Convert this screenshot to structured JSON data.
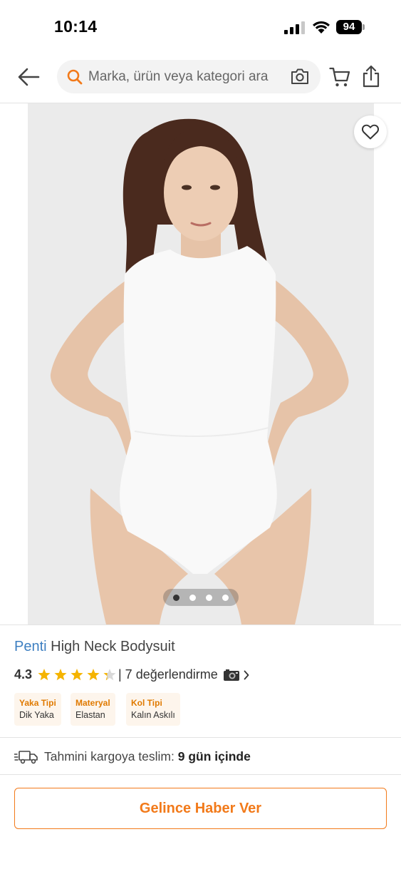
{
  "status_bar": {
    "time": "10:14",
    "battery": "94"
  },
  "search": {
    "placeholder": "Marka, ürün veya kategori ara"
  },
  "carousel": {
    "total": 4,
    "active": 1
  },
  "product": {
    "brand": "Penti",
    "name": "High Neck Bodysuit",
    "rating": "4.3",
    "rating_value": 4.3,
    "review_text": "| 7 değerlendirme",
    "attributes": [
      {
        "label": "Yaka Tipi",
        "value": "Dik Yaka"
      },
      {
        "label": "Materyal",
        "value": "Elastan"
      },
      {
        "label": "Kol Tipi",
        "value": "Kalın Askılı"
      }
    ]
  },
  "delivery": {
    "label": "Tahmini kargoya teslim:",
    "value": "9 gün içinde"
  },
  "cta": {
    "label": "Gelince Haber Ver"
  },
  "colors": {
    "accent": "#f27a1a",
    "brand": "#3d7fc1",
    "star": "#f5b400",
    "tag_bg": "#fdf5ec"
  },
  "icons": [
    "back-arrow-icon",
    "search-icon",
    "camera-icon",
    "cart-icon",
    "share-icon",
    "heart-icon",
    "star-icon",
    "photo-icon",
    "chevron-right-icon",
    "truck-icon"
  ]
}
